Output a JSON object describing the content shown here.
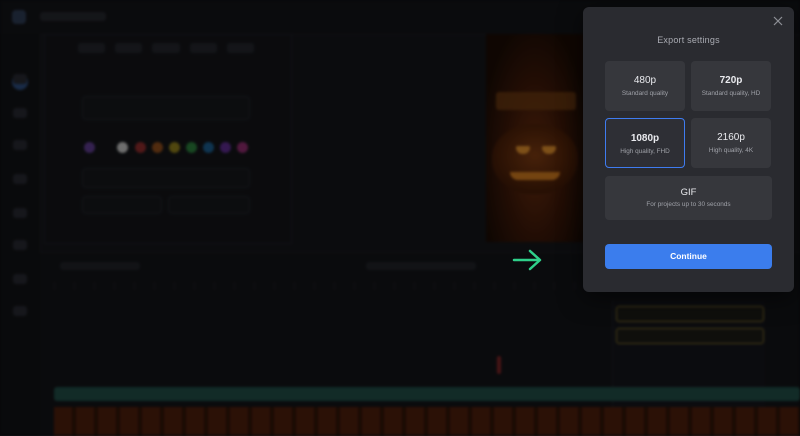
{
  "modal": {
    "title": "Export settings",
    "options": [
      {
        "label": "480p",
        "description": "Standard quality"
      },
      {
        "label": "720p",
        "description": "Standard quality, HD"
      },
      {
        "label": "1080p",
        "description": "High quality, FHD",
        "selected": true
      },
      {
        "label": "2160p",
        "description": "High quality, 4K"
      }
    ],
    "gif": {
      "label": "GIF",
      "description": "For projects up to 30 seconds"
    },
    "continue_label": "Continue"
  },
  "colors": {
    "accent": "#3b7ded",
    "selected_border": "#3f7cf0",
    "arrow": "#2fd08a",
    "modal_bg": "#2a2b30"
  },
  "icons": {
    "close": "close-icon",
    "arrow": "arrow-right-icon"
  }
}
